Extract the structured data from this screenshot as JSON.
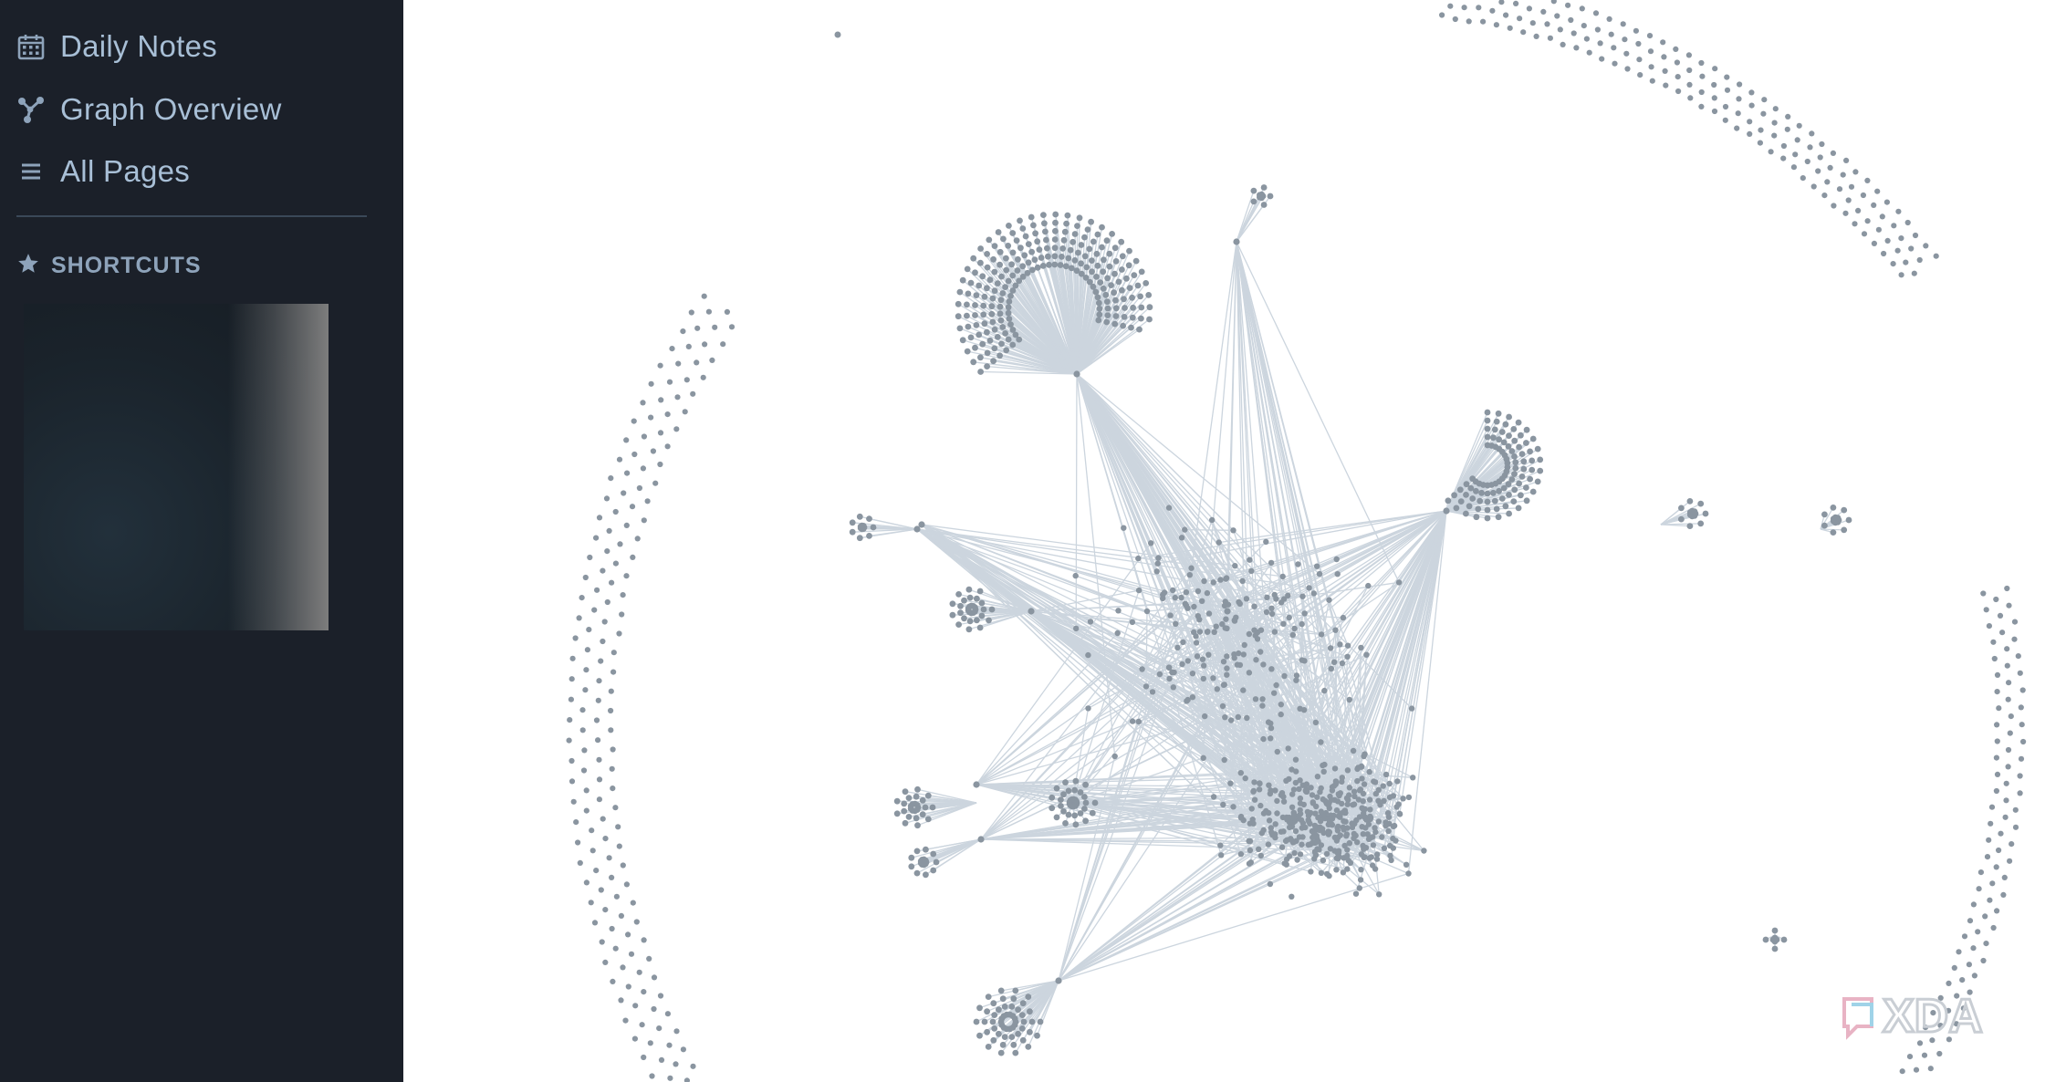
{
  "sidebar": {
    "items": [
      {
        "label": "Daily Notes",
        "icon": "calendar-icon"
      },
      {
        "label": "Graph Overview",
        "icon": "graph-icon"
      },
      {
        "label": "All Pages",
        "icon": "list-icon"
      }
    ],
    "shortcuts": {
      "label": "SHORTCUTS",
      "icon": "star-icon"
    }
  },
  "graph": {
    "node_color": "#8a95a0",
    "edge_color": "#ccd5de"
  },
  "watermark": {
    "text": "XDA"
  },
  "colors": {
    "sidebar_bg": "#1b2029",
    "sidebar_text": "#a8bfd6",
    "canvas_bg": "#ffffff"
  }
}
